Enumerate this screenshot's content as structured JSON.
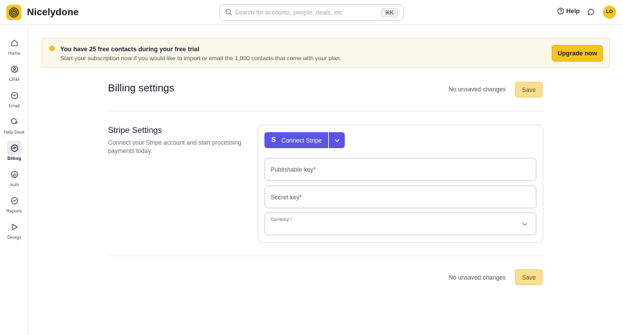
{
  "app": {
    "name": "Nicelydone",
    "avatar_initials": "LO"
  },
  "topbar": {
    "search_placeholder": "Search for accounts, people, deals, etc",
    "search_shortcut": "⌘K",
    "help_label": "Help"
  },
  "sidebar": {
    "items": [
      {
        "label": "Home",
        "icon": "home-icon"
      },
      {
        "label": "CRM",
        "icon": "crm-icon"
      },
      {
        "label": "Email",
        "icon": "email-icon"
      },
      {
        "label": "Help Desk",
        "icon": "help-desk-icon"
      },
      {
        "label": "Billing",
        "icon": "billing-icon",
        "active": true
      },
      {
        "label": "Auth",
        "icon": "auth-icon"
      },
      {
        "label": "Reports",
        "icon": "reports-icon"
      },
      {
        "label": "Design",
        "icon": "design-icon"
      }
    ]
  },
  "banner": {
    "title": "You have 25 free contacts during your free trial",
    "text": "Start your subscription now if you would like to import or email the 1,000 contacts that come with your plan.",
    "cta": "Upgrade now"
  },
  "billing": {
    "title": "Billing settings",
    "status": "No unsaved changes",
    "save_label": "Save"
  },
  "stripe": {
    "title": "Stripe Settings",
    "description": "Connect your Stripe account and start processing payments today.",
    "connect_label": "Connect Stripe",
    "connect_icon_letter": "S",
    "fields": {
      "publishable_key": "Publishable key",
      "secret_key": "Secret key",
      "currency": "Currency",
      "required_mark": "*"
    }
  },
  "footer": {
    "status": "No unsaved changes",
    "save_label": "Save"
  },
  "colors": {
    "brand": "#f5c518",
    "stripe": "#5a54e8",
    "save_disabled": "#f9df8e"
  }
}
